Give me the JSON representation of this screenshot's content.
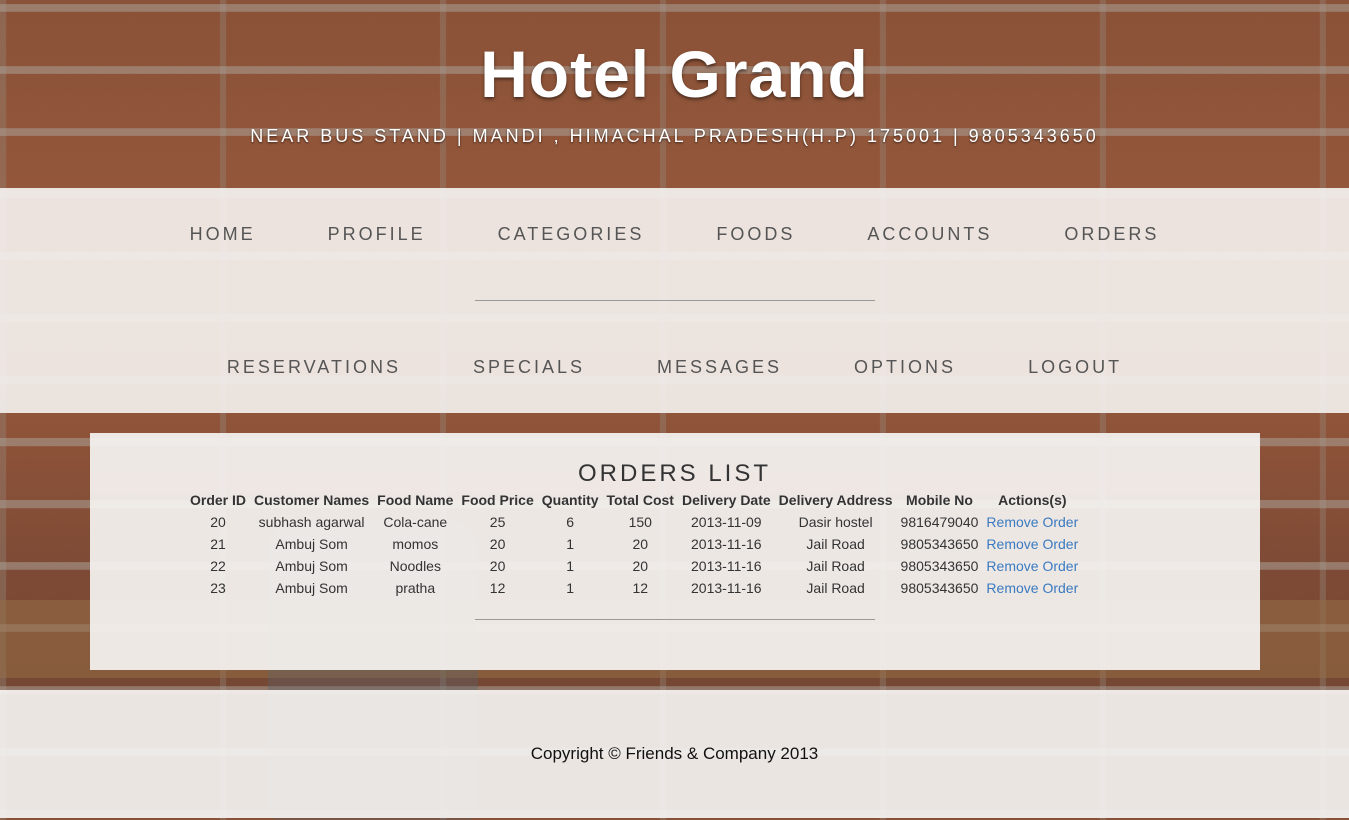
{
  "header": {
    "title": "Hotel Grand",
    "address": "NEAR BUS STAND | MANDI , HIMACHAL PRADESH(H.P) 175001 | 9805343650"
  },
  "nav": {
    "row1": [
      "HOME",
      "PROFILE",
      "CATEGORIES",
      "FOODS",
      "ACCOUNTS",
      "ORDERS"
    ],
    "row2": [
      "RESERVATIONS",
      "SPECIALS",
      "MESSAGES",
      "OPTIONS",
      "LOGOUT"
    ]
  },
  "orders": {
    "title": "ORDERS LIST",
    "columns": [
      "Order ID",
      "Customer Names",
      "Food Name",
      "Food Price",
      "Quantity",
      "Total Cost",
      "Delivery Date",
      "Delivery Address",
      "Mobile No",
      "Actions(s)"
    ],
    "rows": [
      [
        "20",
        "subhash agarwal",
        "Cola-cane",
        "25",
        "6",
        "150",
        "2013-11-09",
        "Dasir hostel",
        "9816479040",
        "Remove Order"
      ],
      [
        "21",
        "Ambuj Som",
        "momos",
        "20",
        "1",
        "20",
        "2013-11-16",
        "Jail Road",
        "9805343650",
        "Remove Order"
      ],
      [
        "22",
        "Ambuj Som",
        "Noodles",
        "20",
        "1",
        "20",
        "2013-11-16",
        "Jail Road",
        "9805343650",
        "Remove Order"
      ],
      [
        "23",
        "Ambuj Som",
        "pratha",
        "12",
        "1",
        "12",
        "2013-11-16",
        "Jail Road",
        "9805343650",
        "Remove Order"
      ]
    ]
  },
  "footer": {
    "copyright": "Copyright © Friends & Company 2013"
  },
  "colors": {
    "link": "#3a7ac0",
    "nav_text": "#555555",
    "panel_bg": "#f5f3f1"
  }
}
